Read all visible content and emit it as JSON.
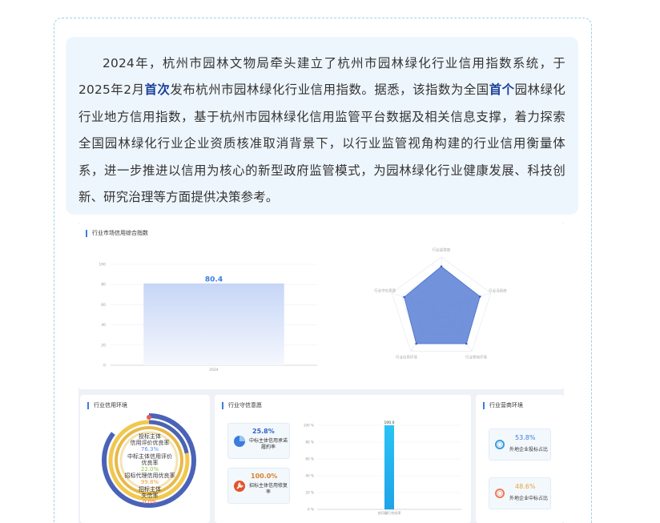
{
  "intro": {
    "part1": "2024年，杭州市园林文物局牵头建立了杭州市园林绿化行业信用指数系统，于2025年2月",
    "emph1": "首次",
    "part2": "发布杭州市园林绿化行业信用指数。据悉，该指数为全国",
    "emph2": "首个",
    "part3": "园林绿化行业地方信用指数，基于杭州市园林绿化信用监管平台数据及相关信息支撑，着力探索全国园林绿化行业企业资质核准取消背景下，以行业监管视角构建的行业信用衡量体系，进一步推进以信用为核心的新型政府监管模式，为园林绿化行业健康发展、科技创新、研究治理等方面提供决策参考。"
  },
  "dashboard": {
    "composite_title": "行业市场信用综合指数",
    "env_title": "行业信用环境",
    "integrity_title": "行业守信意愿",
    "business_title": "行业营商环境",
    "donut_labels": {
      "l1": "投标主体",
      "l2": "信用评价优良率",
      "v1": "76.3%",
      "l3": "中标主体信用评价",
      "l4": "优良率",
      "v2": "22.0%",
      "l5": "招标代理信用优良率",
      "v3": "99.8%",
      "l6": "招标主体",
      "l7": "失信率",
      "v4": "0.0%"
    },
    "integrity_metrics": [
      {
        "value": "25.8%",
        "label": "中标主体信用承诺履約率"
      },
      {
        "value": "100.0%",
        "label": "招标主体信用修复率"
      }
    ],
    "business_metrics": [
      {
        "value": "53.8%",
        "label": "外地企业投标占比"
      },
      {
        "value": "48.6%",
        "label": "外地企业中标占比"
      }
    ],
    "colors": {
      "accent": "#3b7ddd",
      "radar_fill": "#5a7fd6",
      "bar_cyan": "#29c3f5"
    }
  },
  "chart_data": [
    {
      "type": "bar",
      "categories": [
        "2024"
      ],
      "values": [
        80.4
      ],
      "ylim": [
        0,
        100
      ],
      "yticks": [
        "0",
        "20",
        "40",
        "60",
        "80",
        "100"
      ],
      "data_labels": [
        "80.4"
      ]
    },
    {
      "type": "radar",
      "indicators": [
        "行业监管度",
        "行业活跃度",
        "行业营商环境",
        "行业信用环境",
        "行业守信意愿"
      ],
      "values": [
        0.82,
        0.78,
        0.82,
        0.82,
        0.75
      ]
    },
    {
      "type": "bar",
      "categories": [
        "合同履行完成率"
      ],
      "values": [
        100.0
      ],
      "ylim": [
        0,
        100
      ],
      "yticks": [
        "0 %",
        "20 %",
        "40 %",
        "60 %",
        "80 %",
        "100 %"
      ],
      "data_labels": [
        "100.0"
      ]
    }
  ]
}
